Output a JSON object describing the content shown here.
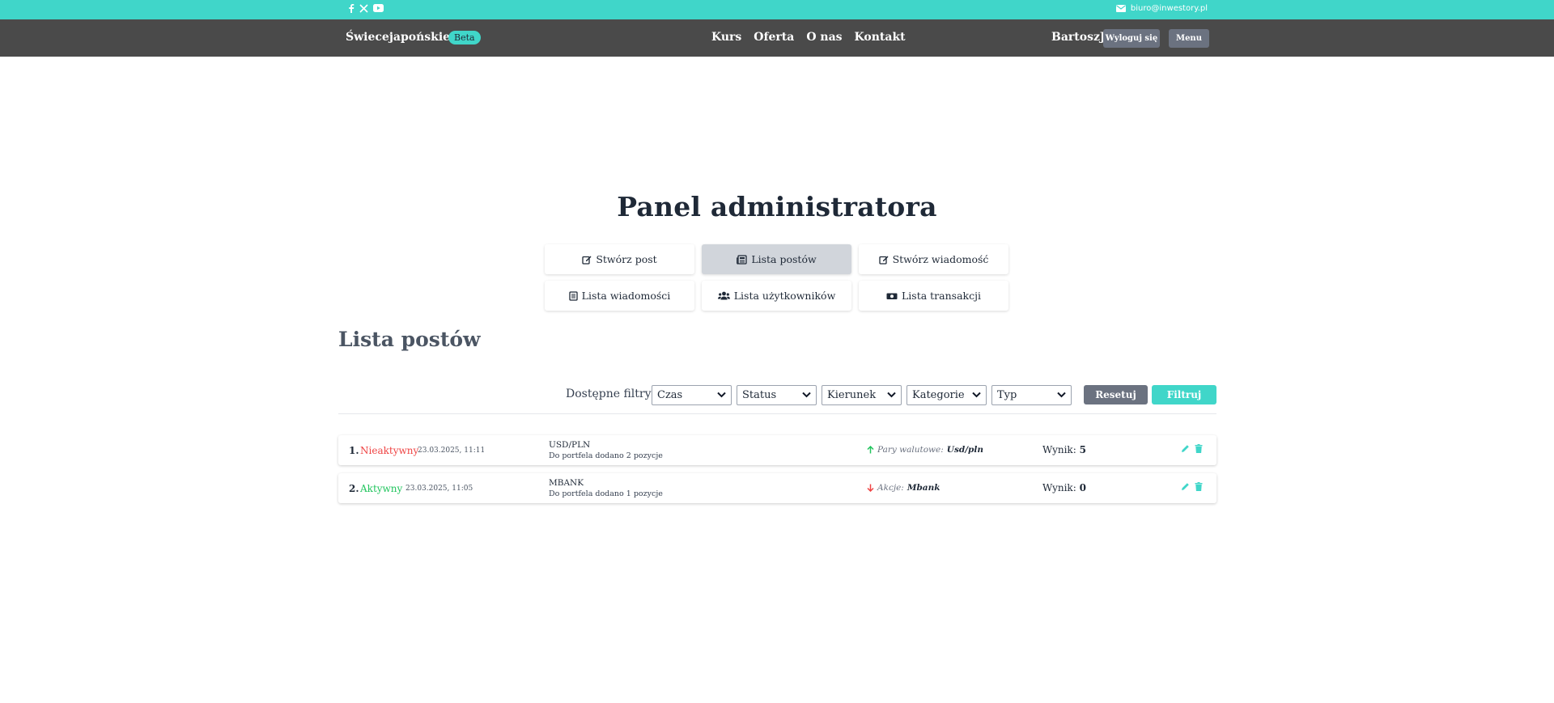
{
  "topbar": {
    "social_icons": [
      "facebook-icon",
      "x-icon",
      "youtube-icon"
    ],
    "email": "biuro@inwestory.pl",
    "bg_color": "#40d6c9"
  },
  "navbar": {
    "brand": "Świecejapońskie.pl",
    "badge": "Beta",
    "links": [
      "Kurs",
      "Oferta",
      "O nas",
      "Kontakt"
    ],
    "username": "BartoszJ",
    "logout_label": "Wyloguj się",
    "menu_label": "Menu",
    "bg_color": "#4a4a4a"
  },
  "page": {
    "title": "Panel administratora"
  },
  "admin_menu": [
    {
      "label": "Stwórz post",
      "icon": "edit-square-icon",
      "active": false
    },
    {
      "label": "Lista postów",
      "icon": "newspaper-icon",
      "active": true
    },
    {
      "label": "Stwórz wiadomość",
      "icon": "edit-square-icon",
      "active": false
    },
    {
      "label": "Lista wiadomości",
      "icon": "document-list-icon",
      "active": false
    },
    {
      "label": "Lista użytkowników",
      "icon": "users-icon",
      "active": false
    },
    {
      "label": "Lista transakcji",
      "icon": "money-bill-icon",
      "active": false
    }
  ],
  "section": {
    "title": "Lista postów"
  },
  "filters": {
    "label": "Dostępne filtry:",
    "selects": [
      "Czas",
      "Status",
      "Kierunek",
      "Kategorie",
      "Typ"
    ],
    "reset_label": "Resetuj",
    "filter_label": "Filtruj"
  },
  "posts": [
    {
      "number": "1.",
      "status": "Nieaktywny",
      "status_color": "#ef4444",
      "date": "23.03.2025, 11:11",
      "asset": "USD/PLN",
      "description": "Do portfela dodano 2 pozycje",
      "direction": "up",
      "direction_color": "#22c55e",
      "category_label": "Pary walutowe:",
      "category_value": "Usd/pln",
      "score_label": "Wynik:",
      "score_value": "5"
    },
    {
      "number": "2.",
      "status": "Aktywny",
      "status_color": "#22c55e",
      "date": "23.03.2025, 11:05",
      "asset": "MBANK",
      "description": "Do portfela dodano 1 pozycje",
      "direction": "down",
      "direction_color": "#ef4444",
      "category_label": "Akcje:",
      "category_value": "Mbank",
      "score_label": "Wynik:",
      "score_value": "0"
    }
  ]
}
